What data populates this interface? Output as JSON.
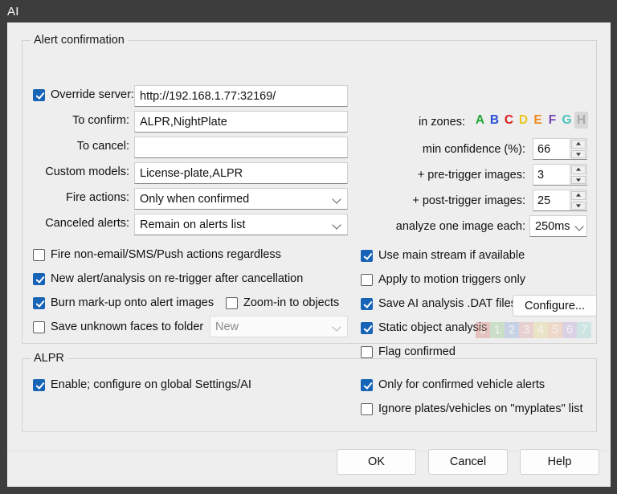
{
  "window": {
    "title": "AI"
  },
  "colors": {
    "accent": "#1763b6",
    "titlebar_bg": "#3d3d3d",
    "client_bg": "#eeeeee"
  },
  "alert_group": {
    "legend": "Alert confirmation",
    "override_server": {
      "label": "Override server:",
      "checked": true,
      "value": "http://192.168.1.77:32169/"
    },
    "fields": [
      {
        "label": "To confirm:",
        "value": "ALPR,NightPlate"
      },
      {
        "label": "To cancel:",
        "value": ""
      },
      {
        "label": "Custom models:",
        "value": "License-plate,ALPR"
      }
    ],
    "fire_actions": {
      "label": "Fire actions:",
      "value": "Only when confirmed"
    },
    "canceled_alerts": {
      "label": "Canceled alerts:",
      "value": "Remain on alerts list"
    },
    "zones": {
      "label": "in zones:",
      "items": [
        {
          "letter": "A",
          "color": "#22a637",
          "enabled": true
        },
        {
          "letter": "B",
          "color": "#2a4fd6",
          "enabled": true
        },
        {
          "letter": "C",
          "color": "#e01b1b",
          "enabled": true
        },
        {
          "letter": "D",
          "color": "#e8c520",
          "enabled": true
        },
        {
          "letter": "E",
          "color": "#ee8a1e",
          "enabled": true
        },
        {
          "letter": "F",
          "color": "#7b44b5",
          "enabled": true
        },
        {
          "letter": "G",
          "color": "#49c2bb",
          "enabled": true
        },
        {
          "letter": "H",
          "color": "#a9a9a9",
          "enabled": false
        }
      ]
    },
    "min_confidence": {
      "label": "min confidence (%):",
      "value": "66"
    },
    "pre_trigger": {
      "label": "+ pre-trigger images:",
      "value": "3"
    },
    "post_trigger": {
      "label": "+ post-trigger images:",
      "value": "25"
    },
    "analyze_interval": {
      "label": "analyze one image each:",
      "value": "250ms"
    },
    "checkboxes_left": [
      {
        "label": "Fire non-email/SMS/Push actions regardless",
        "checked": false
      },
      {
        "label": "New alert/analysis on re-trigger after cancellation",
        "checked": true
      },
      {
        "label": "Burn mark-up onto alert images",
        "checked": true
      },
      {
        "label": "Save unknown faces to folder",
        "checked": false
      }
    ],
    "zoom_in_objects": {
      "label": "Zoom-in to objects",
      "checked": false
    },
    "faces_folder": {
      "value": "New",
      "disabled": true
    },
    "checkboxes_right": [
      {
        "label": "Use main stream if available",
        "checked": true
      },
      {
        "label": "Apply to motion triggers only",
        "checked": false
      },
      {
        "label": "Save AI analysis .DAT files",
        "checked": true
      },
      {
        "label": "Static object analysis",
        "checked": true
      },
      {
        "label": "Flag confirmed",
        "checked": false
      }
    ],
    "configure_button": "Configure...",
    "flag_digits": [
      {
        "digit": "0",
        "color": "#d4756f"
      },
      {
        "digit": "1",
        "color": "#8cc183"
      },
      {
        "digit": "2",
        "color": "#7f9ed6"
      },
      {
        "digit": "3",
        "color": "#e09a9a"
      },
      {
        "digit": "4",
        "color": "#e3d27e"
      },
      {
        "digit": "5",
        "color": "#eeb186"
      },
      {
        "digit": "6",
        "color": "#b89ed6"
      },
      {
        "digit": "7",
        "color": "#8fd2cd"
      }
    ]
  },
  "alpr_group": {
    "legend": "ALPR",
    "enable": {
      "label": "Enable; configure on global Settings/AI",
      "checked": true
    },
    "only_confirmed": {
      "label": "Only for confirmed vehicle alerts",
      "checked": true
    },
    "ignore_plates": {
      "label": "Ignore plates/vehicles on \"myplates\" list",
      "checked": false
    }
  },
  "footer": {
    "ok": "OK",
    "cancel": "Cancel",
    "help": "Help"
  }
}
